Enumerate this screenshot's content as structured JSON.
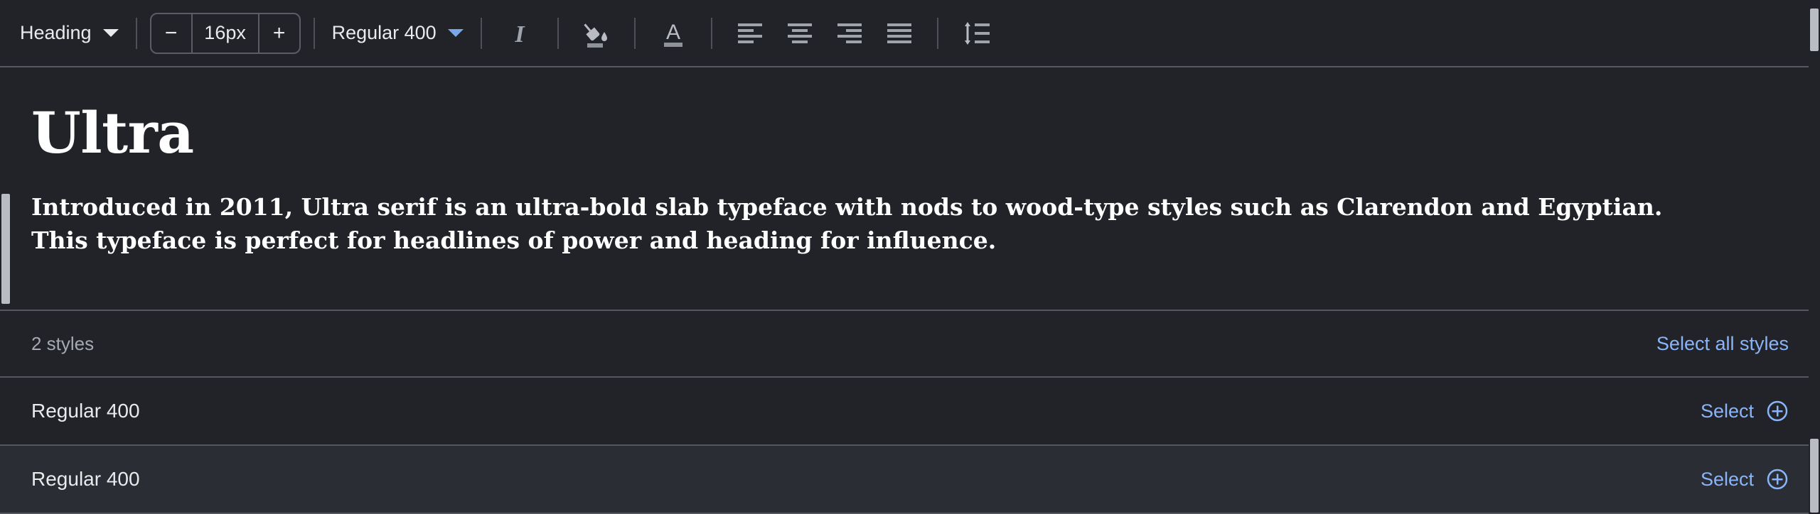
{
  "toolbar": {
    "block_style": {
      "label": "Heading",
      "icon": "chevron-down-icon"
    },
    "font_size": {
      "value": "16px",
      "decrease_label": "−",
      "increase_label": "+"
    },
    "font_weight": {
      "label": "Regular 400",
      "icon": "chevron-down-icon"
    },
    "buttons": [
      {
        "name": "italic-icon",
        "title": "Italic"
      },
      {
        "name": "fill-color-icon",
        "title": "Fill color"
      },
      {
        "name": "text-color-icon",
        "title": "Text color"
      },
      {
        "name": "align-left-icon",
        "title": "Align left"
      },
      {
        "name": "align-center-icon",
        "title": "Align center"
      },
      {
        "name": "align-right-icon",
        "title": "Align right"
      },
      {
        "name": "align-justify-icon",
        "title": "Justify"
      },
      {
        "name": "line-height-icon",
        "title": "Line height"
      }
    ]
  },
  "preview": {
    "font_name": "Ultra",
    "description": "Introduced in 2011, Ultra serif is an ultra-bold slab typeface with nods to wood-type styles such as Clarendon and Egyptian. This typeface is perfect for headlines of power and heading for influence."
  },
  "styles": {
    "count_label": "2 styles",
    "select_all_label": "Select all styles",
    "rows": [
      {
        "name": "Regular 400",
        "action_label": "Select",
        "action_icon": "plus-circle-icon"
      },
      {
        "name": "Regular 400",
        "action_label": "Select",
        "action_icon": "plus-circle-icon"
      }
    ]
  },
  "colors": {
    "background": "#212329",
    "row_hover": "#2a2d33",
    "divider": "#55585f",
    "accent_blue": "#8ab4f8",
    "text_primary": "#e9eaec",
    "text_muted": "#a6a9b0",
    "scrollbar": "#b9bcc2"
  }
}
